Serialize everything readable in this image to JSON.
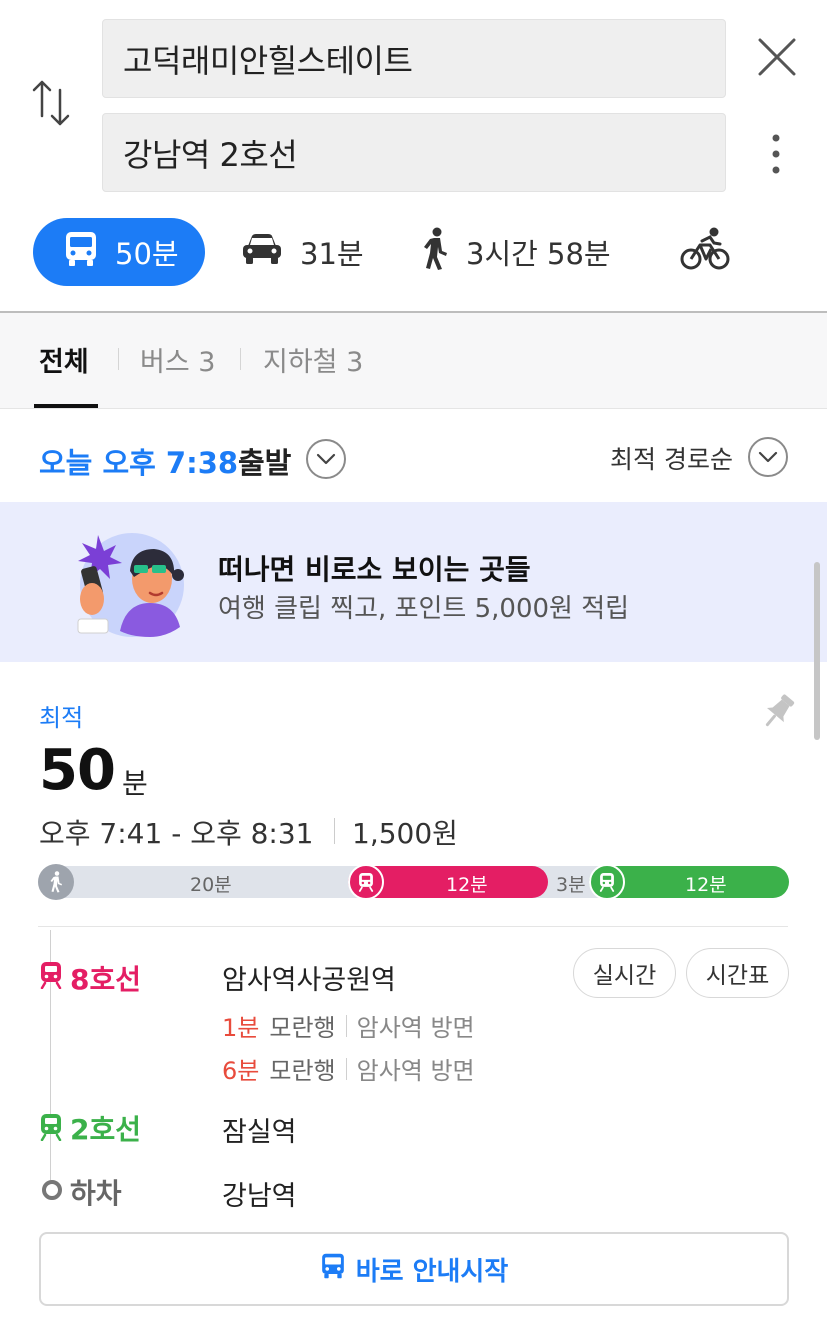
{
  "search": {
    "origin": "고덕래미안힐스테이트",
    "destination": "강남역 2호선"
  },
  "modes": {
    "transit": "50분",
    "car": "31분",
    "walk": "3시간 58분"
  },
  "tabs": {
    "all": "전체",
    "bus": "버스 3",
    "subway": "지하철 3"
  },
  "departure": {
    "time": "오늘 오후 7:38",
    "label": "출발",
    "sort": "최적 경로순"
  },
  "banner": {
    "title": "떠나면 비로소 보이는 곳들",
    "subtitle": "여행 클립 찍고, 포인트 5,000원 적립"
  },
  "route": {
    "badge": "최적",
    "duration_value": "50",
    "duration_unit": "분",
    "time_range": "오후 7:41 - 오후 8:31",
    "fare": "1,500원",
    "segments": {
      "walk": "20분",
      "line8": "12분",
      "transfer": "3분",
      "line2": "12분"
    },
    "steps": {
      "line8_name": "8호선",
      "line8_station": "암사역사공원역",
      "realtime_button": "실시간",
      "timetable_button": "시간표",
      "arrival1_min": "1분",
      "arrival1_dest": "모란행",
      "arrival1_dir": "암사역 방면",
      "arrival2_min": "6분",
      "arrival2_dest": "모란행",
      "arrival2_dir": "암사역 방면",
      "line2_name": "2호선",
      "line2_station": "잠실역",
      "alight_name": "하차",
      "alight_station": "강남역"
    },
    "start_button": "바로 안내시작"
  },
  "colors": {
    "accent": "#1c7cf6",
    "line8": "#e41e64",
    "line2": "#3bb14a",
    "banner_bg": "#eaedfd"
  }
}
